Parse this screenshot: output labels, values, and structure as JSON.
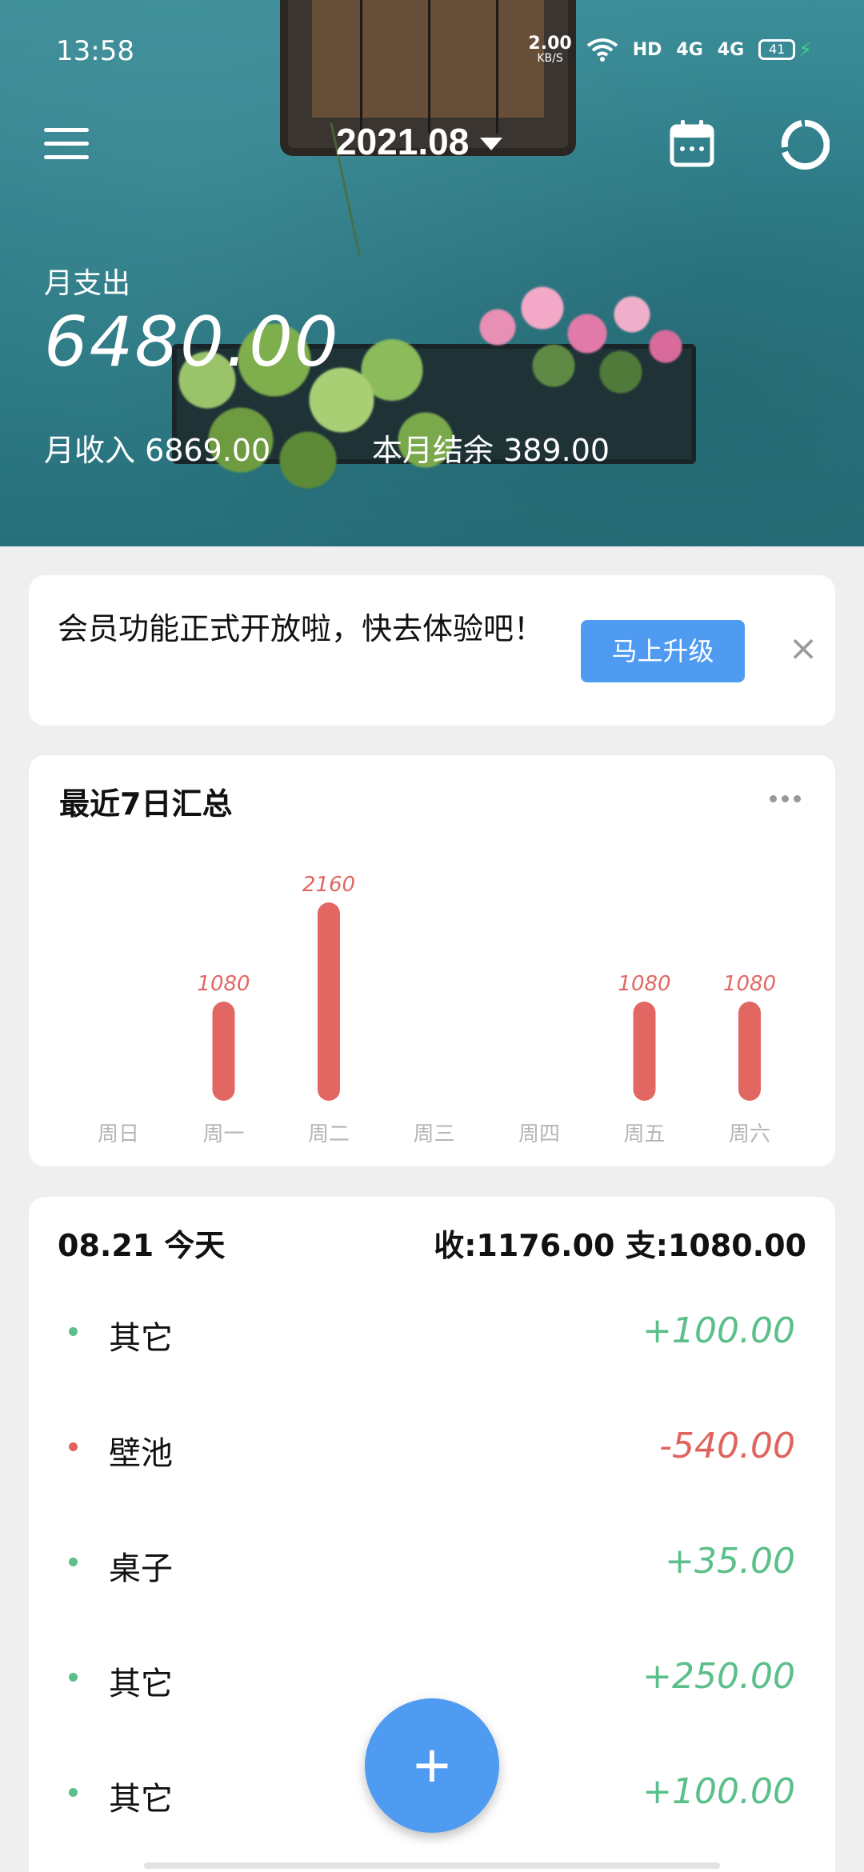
{
  "status_bar": {
    "time": "13:58",
    "net_speed": "2.00",
    "net_unit": "KB/S",
    "hd": "HD",
    "sim1": "4G",
    "sim2": "4G",
    "battery": "41"
  },
  "header": {
    "month": "2021.08",
    "expense_label": "月支出",
    "expense_value": "6480.00",
    "income_text": "月收入 6869.00",
    "balance_text": "本月结余 389.00"
  },
  "promo": {
    "text": "会员功能正式开放啦，快去体验吧！",
    "button_label": "马上升级",
    "close_label": "×"
  },
  "weekly": {
    "title": "最近7日汇总"
  },
  "chart_data": {
    "type": "bar",
    "categories": [
      "周日",
      "周一",
      "周二",
      "周三",
      "周四",
      "周五",
      "周六"
    ],
    "values": [
      0,
      1080,
      2160,
      0,
      0,
      1080,
      1080
    ],
    "title": "最近7日汇总",
    "ylim": [
      0,
      2160
    ]
  },
  "daily": {
    "date": "08.21 今天",
    "totals": "收:1176.00 支:1080.00",
    "items": [
      {
        "name": "其它",
        "amount": "+100.00",
        "type": "income"
      },
      {
        "name": "壁池",
        "amount": "-540.00",
        "type": "expense"
      },
      {
        "name": "桌子",
        "amount": "+35.00",
        "type": "income"
      },
      {
        "name": "其它",
        "amount": "+250.00",
        "type": "income"
      },
      {
        "name": "其它",
        "amount": "+100.00",
        "type": "income"
      }
    ]
  },
  "fab": {
    "label": "+"
  },
  "colors": {
    "income": "#5bbf8a",
    "expense": "#e0635e",
    "bar": "#e26763",
    "accent": "#4f9bf1"
  },
  "icons": {
    "menu": "menu-icon",
    "calendar": "calendar-icon",
    "stats": "pie-chart-icon"
  }
}
